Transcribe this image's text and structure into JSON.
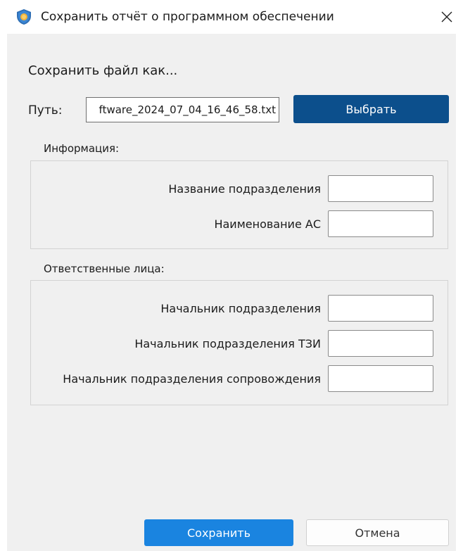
{
  "window": {
    "title": "Сохранить отчёт о программном обеспечении",
    "icon": "shield-icon",
    "close_icon": "close-icon"
  },
  "form": {
    "heading": "Сохранить файл как...",
    "path_label": "Путь:",
    "path_value": "ftware_2024_07_04_16_46_58.txt",
    "choose_label": "Выбрать"
  },
  "info_group": {
    "title": "Информация:",
    "fields": [
      {
        "label": "Название подразделения",
        "value": ""
      },
      {
        "label": "Наименование АС",
        "value": ""
      }
    ]
  },
  "responsible_group": {
    "title": "Ответственные лица:",
    "fields": [
      {
        "label": "Начальник подразделения",
        "value": ""
      },
      {
        "label": "Начальник подразделения ТЗИ",
        "value": ""
      },
      {
        "label": "Начальник подразделения сопровождения",
        "value": ""
      }
    ]
  },
  "footer": {
    "save_label": "Сохранить",
    "cancel_label": "Отмена"
  },
  "colors": {
    "accent_dark": "#0c4f8c",
    "accent": "#1a84e0",
    "panel": "#f0f0f0"
  }
}
